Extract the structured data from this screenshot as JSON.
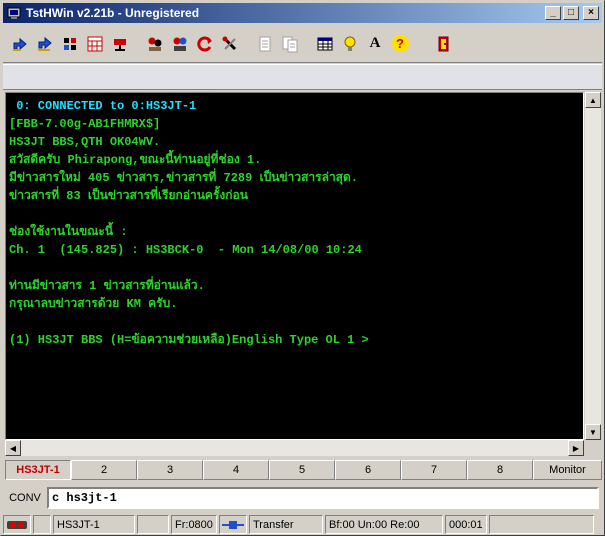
{
  "window": {
    "title": "TstHWin v2.21b - Unregistered"
  },
  "titlebar_buttons": {
    "minimize": "_",
    "maximize": "□",
    "close": "×"
  },
  "toolbar": {
    "icons": [
      "connect-icon",
      "disconnect-icon",
      "station-icon",
      "calendar-icon",
      "antenna-icon",
      "nodes-icon",
      "users-icon",
      "refresh-icon",
      "tools-icon",
      "document-icon",
      "documents-icon",
      "table-icon",
      "bulb-icon",
      "font-icon",
      "help-icon",
      "exit-icon"
    ],
    "font_glyph": "A",
    "help_glyph": "?"
  },
  "terminal": {
    "lines": [
      {
        "text": " 0: CONNECTED to 0:HS3JT-1",
        "style": "cyan"
      },
      {
        "text": "[FBB-7.00g-AB1FHMRX$]",
        "style": "green"
      },
      {
        "text": "HS3JT BBS,QTH OK04WV.",
        "style": "green"
      },
      {
        "text": "สวัสดีครับ Phirapong,ขณะนี้ท่านอยู่ที่ช่อง 1.",
        "style": "green"
      },
      {
        "text": "มีข่าวสารใหม่ 405 ข่าวสาร,ข่าวสารที่ 7289 เป็นข่าวสารล่าสุด.",
        "style": "green"
      },
      {
        "text": "ข่าวสารที่ 83 เป็นข่าวสารที่เรียกอ่านครั้งก่อน",
        "style": "green"
      },
      {
        "text": "",
        "style": "green"
      },
      {
        "text": "ช่องใช้งานในขณะนี้ :",
        "style": "green"
      },
      {
        "text": "Ch. 1  (145.825) : HS3BCK-0  - Mon 14/08/00 10:24",
        "style": "green"
      },
      {
        "text": "",
        "style": "green"
      },
      {
        "text": "ท่านมีข่าวสาร 1 ข่าวสารที่อ่านแล้ว.",
        "style": "green"
      },
      {
        "text": "กรุณาลบข่าวสารด้วย KM ครับ.",
        "style": "green"
      },
      {
        "text": "",
        "style": "green"
      },
      {
        "text": "(1) HS3JT BBS (H=ข้อความช่วยเหลือ)English Type OL 1 >",
        "style": "green"
      }
    ]
  },
  "scroll": {
    "up": "▲",
    "down": "▼",
    "left": "◀",
    "right": "▶"
  },
  "tabs": [
    "HS3JT-1",
    "2",
    "3",
    "4",
    "5",
    "6",
    "7",
    "8",
    "Monitor"
  ],
  "active_tab": 0,
  "conv": {
    "label": "CONV",
    "value": "c hs3jt-1"
  },
  "status": {
    "callsign": "HS3JT-1",
    "frame": "Fr:0800",
    "transfer": "Transfer",
    "buffers": "Bf:00 Un:00 Re:00",
    "timer": "000:01"
  },
  "colors": {
    "title_start": "#0a246a",
    "title_end": "#a6caf0",
    "terminal_bg": "#000000",
    "terminal_text": "#2bd42b",
    "terminal_header": "#20e0ff",
    "active_tab_text": "#c00000",
    "chrome": "#d4d0c8"
  }
}
